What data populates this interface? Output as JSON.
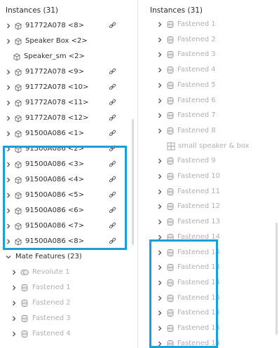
{
  "left": {
    "header": "Instances (31)",
    "rows": [
      {
        "label": "91772A078 <8>",
        "chevron": true,
        "link": true
      },
      {
        "label": "Speaker Box <2>",
        "chevron": true,
        "link": false
      },
      {
        "label": "Speaker_sm <2>",
        "chevron": false,
        "link": false
      },
      {
        "label": "91772A078 <9>",
        "chevron": true,
        "link": true
      },
      {
        "label": "91772A078 <10>",
        "chevron": true,
        "link": true
      },
      {
        "label": "91772A078 <11>",
        "chevron": true,
        "link": true
      },
      {
        "label": "91772A078 <12>",
        "chevron": true,
        "link": true
      },
      {
        "label": "91500A086 <1>",
        "chevron": true,
        "link": true
      },
      {
        "label": "91500A086 <2>",
        "chevron": true,
        "link": true
      },
      {
        "label": "91500A086 <3>",
        "chevron": true,
        "link": true
      },
      {
        "label": "91500A086 <4>",
        "chevron": true,
        "link": true
      },
      {
        "label": "91500A086 <5>",
        "chevron": true,
        "link": true
      },
      {
        "label": "91500A086 <6>",
        "chevron": true,
        "link": true
      },
      {
        "label": "91500A086 <7>",
        "chevron": true,
        "link": true
      },
      {
        "label": "91500A086 <8>",
        "chevron": true,
        "link": true
      }
    ],
    "mate_section_label": "Mate Features (23)",
    "mate_rows": [
      {
        "label": "Revolute 1",
        "icon": "revolute-icon"
      },
      {
        "label": "Fastened 1",
        "icon": "fastened-icon"
      },
      {
        "label": "Fastened 2",
        "icon": "fastened-icon"
      },
      {
        "label": "Fastened 3",
        "icon": "fastened-icon"
      },
      {
        "label": "Fastened 4",
        "icon": "fastened-icon"
      }
    ]
  },
  "right": {
    "header": "Instances (31)",
    "rows": [
      {
        "label": "Fastened 1",
        "type": "fastened"
      },
      {
        "label": "Fastened 2",
        "type": "fastened"
      },
      {
        "label": "Fastened 3",
        "type": "fastened"
      },
      {
        "label": "Fastened 4",
        "type": "fastened"
      },
      {
        "label": "Fastened 5",
        "type": "fastened"
      },
      {
        "label": "Fastened 6",
        "type": "fastened"
      },
      {
        "label": "Fastened 7",
        "type": "fastened"
      },
      {
        "label": "Fastened 8",
        "type": "fastened"
      },
      {
        "label": "small speaker & box",
        "type": "group"
      },
      {
        "label": "Fastened 9",
        "type": "fastened"
      },
      {
        "label": "Fastened 10",
        "type": "fastened"
      },
      {
        "label": "Fastened 11",
        "type": "fastened"
      },
      {
        "label": "Fastened 12",
        "type": "fastened"
      },
      {
        "label": "Fastened 13",
        "type": "fastened"
      },
      {
        "label": "Fastened 14",
        "type": "fastened"
      },
      {
        "label": "Fastened 14",
        "type": "fastened"
      },
      {
        "label": "Fastened 14",
        "type": "fastened"
      },
      {
        "label": "Fastened 14",
        "type": "fastened"
      },
      {
        "label": "Fastened 14",
        "type": "fastened"
      },
      {
        "label": "Fastened 14",
        "type": "fastened"
      },
      {
        "label": "Fastened 14",
        "type": "fastened"
      },
      {
        "label": "Fastened 14",
        "type": "fastened"
      }
    ]
  },
  "colors": {
    "highlight": "#1aa0d8",
    "text_dark": "#2f2f2f",
    "text_faded": "#b0b0b0"
  }
}
